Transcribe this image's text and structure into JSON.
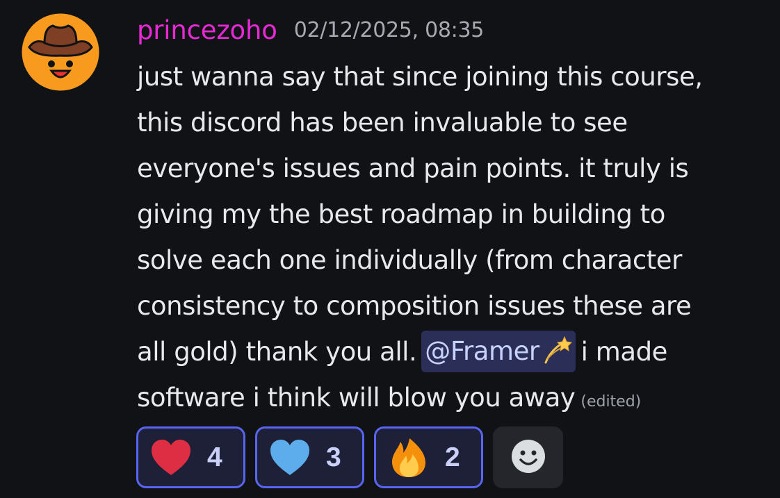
{
  "message": {
    "username": "princezoho",
    "timestamp": "02/12/2025, 08:35",
    "lines": [
      "just wanna say that since joining this course,",
      "this discord has been invaluable to see",
      "everyone's issues and pain points. it truly is",
      "giving my the best roadmap in building to",
      "solve each one individually (from character",
      "consistency to composition issues these are"
    ],
    "line7_before": "all gold) thank you all.",
    "mention": "@Framer",
    "mention_emoji": "dizzy-emoji",
    "line7_after": "i made",
    "line8": "software i think will blow you away",
    "edited_label": "(edited)"
  },
  "reactions": [
    {
      "emoji": "red-heart-emoji",
      "count": "4"
    },
    {
      "emoji": "blue-heart-emoji",
      "count": "3"
    },
    {
      "emoji": "fire-emoji",
      "count": "2"
    }
  ],
  "add_reaction_icon": "smiley-icon",
  "colors": {
    "background": "#111215",
    "username": "#e829d6",
    "reaction_border": "#5865f2",
    "mention_bg": "#2b2f58"
  }
}
